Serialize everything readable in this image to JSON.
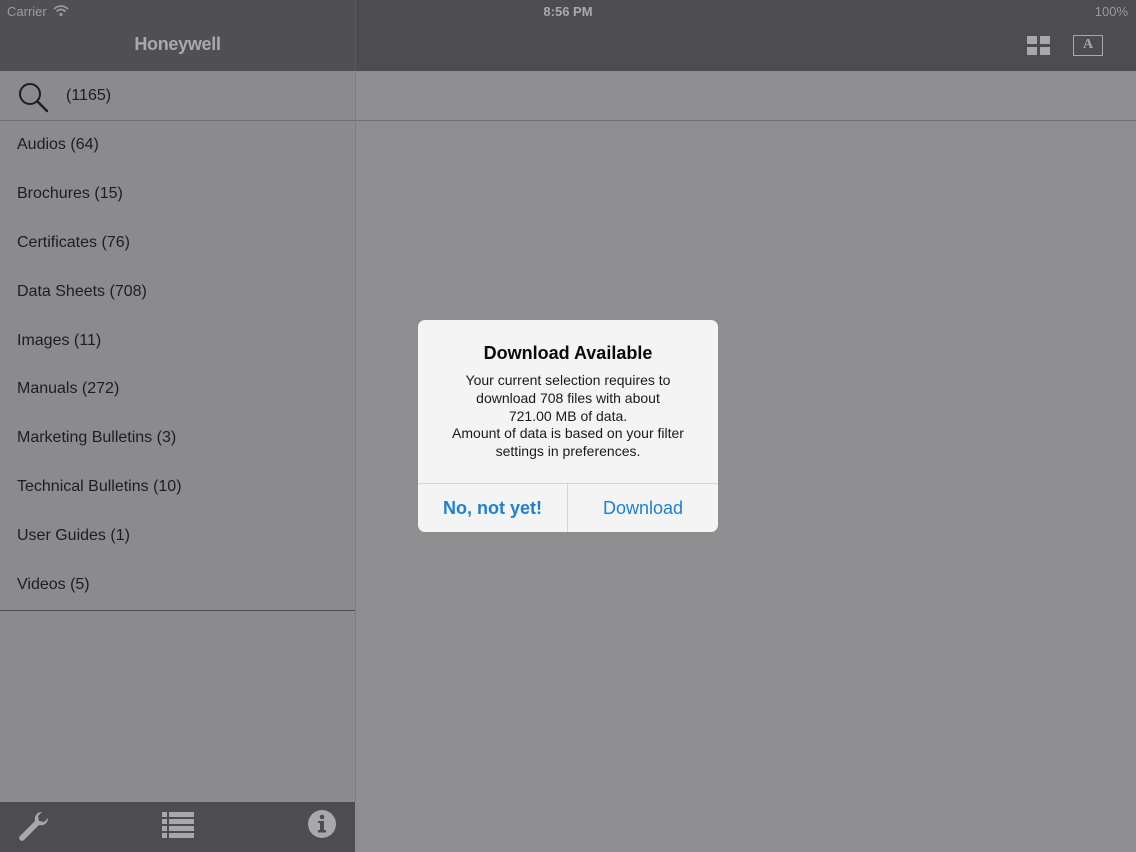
{
  "status_bar": {
    "carrier": "Carrier",
    "time": "8:56 PM",
    "battery": "100%"
  },
  "header": {
    "brand": "Honeywell",
    "font_button_label": "A",
    "icons": [
      "grid-icon",
      "font-size-icon"
    ]
  },
  "sidebar": {
    "search_count": "(1165)",
    "categories": [
      {
        "label": "Audios (64)"
      },
      {
        "label": "Brochures (15)"
      },
      {
        "label": "Certificates (76)"
      },
      {
        "label": "Data Sheets (708)"
      },
      {
        "label": "Images (11)"
      },
      {
        "label": "Manuals (272)"
      },
      {
        "label": "Marketing Bulletins (3)"
      },
      {
        "label": "Technical Bulletins (10)"
      },
      {
        "label": "User Guides (1)"
      },
      {
        "label": "Videos (5)"
      }
    ]
  },
  "toolbar": {
    "icons": [
      "wrench-icon",
      "list-icon",
      "info-icon"
    ]
  },
  "alert": {
    "title": "Download Available",
    "message": "Your current selection requires to\ndownload 708 files with about\n721.00 MB of data.\nAmount of data is based on your filter\nsettings in preferences.",
    "cancel_label": "No, not yet!",
    "confirm_label": "Download"
  },
  "colors": {
    "header_bg": "#4d4c4f",
    "dimmed_bg": "#8e8d90",
    "alert_bg": "#f4f4f4",
    "alert_button": "#1f7fd1"
  }
}
